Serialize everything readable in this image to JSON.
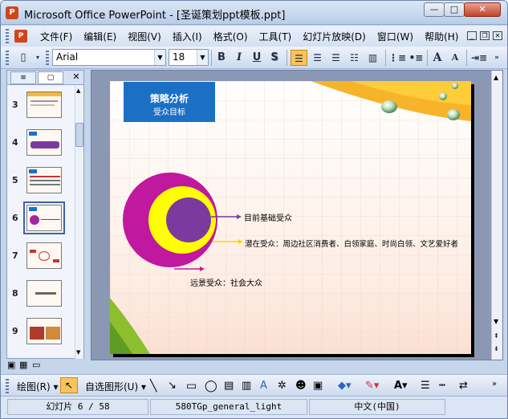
{
  "window": {
    "title": "Microsoft Office PowerPoint - [圣诞策划ppt模板.ppt]",
    "app_icon": "P",
    "min": "—",
    "max": "□",
    "close": "✕"
  },
  "menu": [
    "文件(F)",
    "编辑(E)",
    "视图(V)",
    "插入(I)",
    "格式(O)",
    "工具(T)",
    "幻灯片放映(D)",
    "窗口(W)",
    "帮助(H)"
  ],
  "toolbar": {
    "font": "Arial",
    "size": "18",
    "bold": "B",
    "italic": "I",
    "underline": "U",
    "shadow": "S",
    "grow": "A",
    "shrink": "A"
  },
  "panel": {
    "tab_outline": "≡",
    "tab_slides": "▢",
    "close": "✕"
  },
  "thumbnails": [
    {
      "num": "3",
      "selected": false
    },
    {
      "num": "4",
      "selected": false
    },
    {
      "num": "5",
      "selected": false
    },
    {
      "num": "6",
      "selected": true
    },
    {
      "num": "7",
      "selected": false
    },
    {
      "num": "8",
      "selected": false
    },
    {
      "num": "9",
      "selected": false
    }
  ],
  "slide": {
    "title": "策略分析",
    "subtitle": "受众目标",
    "label_basic": "目前基础受众",
    "label_potential": "潜在受众：周边社区消费者、白领家庭、时尚白领、文艺爱好者",
    "label_distant": "远景受众：社会大众",
    "colors": {
      "outer": "#c0189f",
      "middle": "#ffff00",
      "inner": "#7b3b9e",
      "title_bg": "#1b70c6"
    }
  },
  "drawbar": {
    "draw": "绘图(R) ▾",
    "autoshape": "自选图形(U) ▾"
  },
  "status": {
    "slide": "幻灯片 6 / 58",
    "template": "580TGp_general_light",
    "language": "中文(中国)"
  }
}
